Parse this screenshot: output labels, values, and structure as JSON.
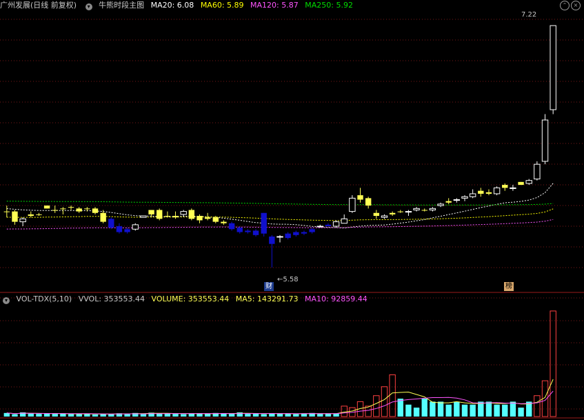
{
  "header": {
    "stock_name": "广州发展(日线 前复权)",
    "indicator_name": "牛熊时段主图",
    "ma20": "MA20: 6.08",
    "ma60": "MA60: 5.89",
    "ma120": "MA120: 5.87",
    "ma250": "MA250: 5.92"
  },
  "vol_header": {
    "name": "VOL-TDX(5,10)",
    "vvol": "VVOL: 353553.44",
    "volume": "VOLUME: 353553.44",
    "ma5": "MA5: 143291.73",
    "ma10": "MA10: 92859.44"
  },
  "labels": {
    "high": "7.22",
    "low": "←5.58",
    "cai": "财",
    "bang": "榜"
  },
  "colors": {
    "background": "#000000",
    "grid": "#7a1818",
    "candle_yellow": "#ffff55",
    "candle_blue": "#1010cc",
    "candle_up_hollow": "#ffffff",
    "vol_up": "#ff4040",
    "vol_down": "#55ffff",
    "ma20": "#ffffff",
    "ma60": "#ffff00",
    "ma120": "#ff55ff",
    "ma250": "#00dd00"
  },
  "chart_data": {
    "type": "candlestick",
    "ylim": [
      5.5,
      7.3
    ],
    "candles": [
      {
        "o": 5.96,
        "h": 6.0,
        "l": 5.92,
        "c": 5.96,
        "k": "y"
      },
      {
        "o": 5.96,
        "h": 5.97,
        "l": 5.87,
        "c": 5.89,
        "k": "y"
      },
      {
        "o": 5.89,
        "h": 5.92,
        "l": 5.86,
        "c": 5.91,
        "k": "u"
      },
      {
        "o": 5.94,
        "h": 5.96,
        "l": 5.92,
        "c": 5.93,
        "k": "y"
      },
      {
        "o": 5.94,
        "h": 5.95,
        "l": 5.93,
        "c": 5.94,
        "k": "y"
      },
      {
        "o": 6.0,
        "h": 6.0,
        "l": 5.98,
        "c": 5.98,
        "k": "y"
      },
      {
        "o": 5.97,
        "h": 6.0,
        "l": 5.95,
        "c": 5.97,
        "k": "y"
      },
      {
        "o": 5.98,
        "h": 5.99,
        "l": 5.94,
        "c": 5.98,
        "k": "y"
      },
      {
        "o": 5.99,
        "h": 6.0,
        "l": 5.97,
        "c": 5.99,
        "k": "y"
      },
      {
        "o": 5.98,
        "h": 5.99,
        "l": 5.95,
        "c": 5.96,
        "k": "y"
      },
      {
        "o": 5.98,
        "h": 5.99,
        "l": 5.96,
        "c": 5.98,
        "k": "y"
      },
      {
        "o": 5.98,
        "h": 5.99,
        "l": 5.94,
        "c": 5.95,
        "k": "y"
      },
      {
        "o": 5.95,
        "h": 5.97,
        "l": 5.88,
        "c": 5.89,
        "k": "y"
      },
      {
        "o": 5.91,
        "h": 5.92,
        "l": 5.84,
        "c": 5.85,
        "k": "b"
      },
      {
        "o": 5.86,
        "h": 5.88,
        "l": 5.81,
        "c": 5.82,
        "k": "b"
      },
      {
        "o": 5.84,
        "h": 5.85,
        "l": 5.81,
        "c": 5.82,
        "k": "b"
      },
      {
        "o": 5.84,
        "h": 5.88,
        "l": 5.83,
        "c": 5.87,
        "k": "u"
      },
      {
        "o": 5.92,
        "h": 5.93,
        "l": 5.92,
        "c": 5.93,
        "k": "u"
      },
      {
        "o": 5.94,
        "h": 5.97,
        "l": 5.92,
        "c": 5.97,
        "k": "y"
      },
      {
        "o": 5.97,
        "h": 5.98,
        "l": 5.9,
        "c": 5.91,
        "k": "y"
      },
      {
        "o": 5.93,
        "h": 5.96,
        "l": 5.92,
        "c": 5.93,
        "k": "y"
      },
      {
        "o": 5.92,
        "h": 5.96,
        "l": 5.91,
        "c": 5.93,
        "k": "y"
      },
      {
        "o": 5.94,
        "h": 5.97,
        "l": 5.93,
        "c": 5.96,
        "k": "u"
      },
      {
        "o": 5.97,
        "h": 5.98,
        "l": 5.9,
        "c": 5.91,
        "k": "y"
      },
      {
        "o": 5.9,
        "h": 5.94,
        "l": 5.88,
        "c": 5.93,
        "k": "y"
      },
      {
        "o": 5.91,
        "h": 5.95,
        "l": 5.9,
        "c": 5.92,
        "k": "y"
      },
      {
        "o": 5.92,
        "h": 5.93,
        "l": 5.88,
        "c": 5.89,
        "k": "y"
      },
      {
        "o": 5.89,
        "h": 5.9,
        "l": 5.87,
        "c": 5.88,
        "k": "y"
      },
      {
        "o": 5.88,
        "h": 5.89,
        "l": 5.83,
        "c": 5.84,
        "k": "b"
      },
      {
        "o": 5.85,
        "h": 5.86,
        "l": 5.81,
        "c": 5.82,
        "k": "b"
      },
      {
        "o": 5.83,
        "h": 5.84,
        "l": 5.81,
        "c": 5.82,
        "k": "b"
      },
      {
        "o": 5.83,
        "h": 5.84,
        "l": 5.79,
        "c": 5.8,
        "k": "b"
      },
      {
        "o": 5.95,
        "h": 5.95,
        "l": 5.79,
        "c": 5.81,
        "k": "b"
      },
      {
        "o": 5.79,
        "h": 5.8,
        "l": 5.58,
        "c": 5.74,
        "k": "b"
      },
      {
        "o": 5.79,
        "h": 5.8,
        "l": 5.75,
        "c": 5.79,
        "k": "u"
      },
      {
        "o": 5.78,
        "h": 5.82,
        "l": 5.77,
        "c": 5.81,
        "k": "b"
      },
      {
        "o": 5.8,
        "h": 5.83,
        "l": 5.79,
        "c": 5.82,
        "k": "b"
      },
      {
        "o": 5.81,
        "h": 5.83,
        "l": 5.8,
        "c": 5.82,
        "k": "b"
      },
      {
        "o": 5.82,
        "h": 5.85,
        "l": 5.81,
        "c": 5.84,
        "k": "b"
      },
      {
        "o": 5.86,
        "h": 5.87,
        "l": 5.85,
        "c": 5.86,
        "k": "u"
      },
      {
        "o": 5.87,
        "h": 5.88,
        "l": 5.86,
        "c": 5.86,
        "k": "b"
      },
      {
        "o": 5.86,
        "h": 5.9,
        "l": 5.85,
        "c": 5.89,
        "k": "u"
      },
      {
        "o": 5.88,
        "h": 5.94,
        "l": 5.88,
        "c": 5.91,
        "k": "u"
      },
      {
        "o": 5.96,
        "h": 6.07,
        "l": 5.95,
        "c": 6.05,
        "k": "u"
      },
      {
        "o": 6.07,
        "h": 6.12,
        "l": 6.02,
        "c": 6.04,
        "k": "y"
      },
      {
        "o": 6.05,
        "h": 6.06,
        "l": 5.98,
        "c": 6.0,
        "k": "y"
      },
      {
        "o": 5.95,
        "h": 5.97,
        "l": 5.91,
        "c": 5.93,
        "k": "y"
      },
      {
        "o": 5.93,
        "h": 5.94,
        "l": 5.91,
        "c": 5.92,
        "k": "u"
      },
      {
        "o": 5.94,
        "h": 5.96,
        "l": 5.93,
        "c": 5.95,
        "k": "y"
      },
      {
        "o": 5.96,
        "h": 5.97,
        "l": 5.95,
        "c": 5.96,
        "k": "y"
      },
      {
        "o": 5.96,
        "h": 5.97,
        "l": 5.93,
        "c": 5.96,
        "k": "u"
      },
      {
        "o": 5.97,
        "h": 5.99,
        "l": 5.96,
        "c": 5.98,
        "k": "u"
      },
      {
        "o": 5.97,
        "h": 5.98,
        "l": 5.96,
        "c": 5.97,
        "k": "y"
      },
      {
        "o": 5.97,
        "h": 5.99,
        "l": 5.96,
        "c": 5.98,
        "k": "u"
      },
      {
        "o": 6.0,
        "h": 6.02,
        "l": 5.99,
        "c": 6.01,
        "k": "u"
      },
      {
        "o": 6.02,
        "h": 6.05,
        "l": 6.01,
        "c": 6.03,
        "k": "y"
      },
      {
        "o": 6.04,
        "h": 6.05,
        "l": 6.02,
        "c": 6.04,
        "k": "u"
      },
      {
        "o": 6.05,
        "h": 6.07,
        "l": 6.03,
        "c": 6.06,
        "k": "u"
      },
      {
        "o": 6.06,
        "h": 6.11,
        "l": 6.05,
        "c": 6.08,
        "k": "u"
      },
      {
        "o": 6.08,
        "h": 6.12,
        "l": 6.06,
        "c": 6.1,
        "k": "y"
      },
      {
        "o": 6.09,
        "h": 6.11,
        "l": 6.07,
        "c": 6.08,
        "k": "y"
      },
      {
        "o": 6.08,
        "h": 6.13,
        "l": 6.07,
        "c": 6.12,
        "k": "u"
      },
      {
        "o": 6.14,
        "h": 6.15,
        "l": 6.1,
        "c": 6.12,
        "k": "y"
      },
      {
        "o": 6.12,
        "h": 6.14,
        "l": 6.1,
        "c": 6.12,
        "k": "u"
      },
      {
        "o": 6.14,
        "h": 6.16,
        "l": 6.14,
        "c": 6.16,
        "k": "y"
      },
      {
        "o": 6.15,
        "h": 6.18,
        "l": 6.14,
        "c": 6.17,
        "k": "u"
      },
      {
        "o": 6.18,
        "h": 6.3,
        "l": 6.17,
        "c": 6.28,
        "k": "u"
      },
      {
        "o": 6.3,
        "h": 6.62,
        "l": 6.28,
        "c": 6.58,
        "k": "u"
      },
      {
        "o": 6.65,
        "h": 7.22,
        "l": 6.62,
        "c": 7.22,
        "k": "u"
      }
    ],
    "vol_up_flags": [
      0,
      0,
      0,
      0,
      0,
      0,
      0,
      0,
      0,
      0,
      0,
      0,
      0,
      0,
      0,
      0,
      0,
      0,
      0,
      0,
      0,
      0,
      0,
      0,
      0,
      0,
      0,
      0,
      0,
      0,
      0,
      0,
      0,
      0,
      0,
      0,
      0,
      0,
      0,
      0,
      0,
      0,
      1,
      1,
      1,
      1,
      1,
      1,
      1,
      0,
      0,
      0,
      0,
      0,
      0,
      0,
      0,
      0,
      0,
      0,
      0,
      0,
      0,
      0,
      0,
      0,
      1,
      1,
      1
    ],
    "volume_wan": [
      1.2,
      0.8,
      1.4,
      1.0,
      0.9,
      1.0,
      0.9,
      1.0,
      0.8,
      0.8,
      1.0,
      0.7,
      0.9,
      0.8,
      1.1,
      1.0,
      1.2,
      0.8,
      1.3,
      1.1,
      1.0,
      0.9,
      0.8,
      1.0,
      1.1,
      0.9,
      1.2,
      1.0,
      0.9,
      1.4,
      0.9,
      1.0,
      0.8,
      1.1,
      1.0,
      0.9,
      0.8,
      1.0,
      1.2,
      0.9,
      0.9,
      1.0,
      3.5,
      3.0,
      5.0,
      3.5,
      7.0,
      10.0,
      14.0,
      6.0,
      4.0,
      3.0,
      6.0,
      5.0,
      5.0,
      4.0,
      5.0,
      4.0,
      4.0,
      5.0,
      5.0,
      4.0,
      4.0,
      5.0,
      3.0,
      5.0,
      7.0,
      12.0,
      35.4
    ]
  }
}
